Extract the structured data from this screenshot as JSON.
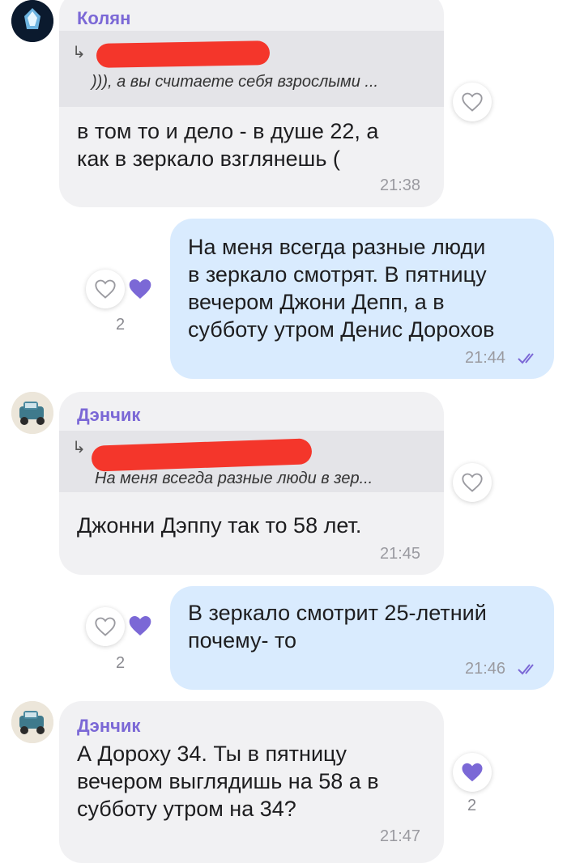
{
  "colors": {
    "incoming_bubble": "#f1f1f3",
    "outgoing_bubble": "#d9ebfe",
    "accent": "#7b68d6",
    "redaction": "#f4362b"
  },
  "messages": [
    {
      "direction": "incoming",
      "sender": "Колян",
      "reply_arrow": "↳",
      "reply_quote": "))), а вы считаете себя взрослыми ...",
      "text_lines": [
        "в том то и дело - в душе 22, а",
        "как в зеркало взглянешь ("
      ],
      "time": "21:38",
      "reaction_icon": "heart-outline-icon"
    },
    {
      "direction": "outgoing",
      "text_lines": [
        "На меня всегда разные люди",
        "в зеркало смотрят. В пятницу",
        "вечером Джони Депп, а в",
        "субботу утром Денис Дорохов"
      ],
      "time": "21:44",
      "status_icon": "double-check-icon",
      "reaction_count": "2"
    },
    {
      "direction": "incoming",
      "sender": "Дэнчик",
      "reply_arrow": "↳",
      "reply_quote": "На меня всегда разные люди в зер...",
      "text_lines": [
        "Джонни Дэппу так то 58 лет."
      ],
      "time": "21:45",
      "reaction_icon": "heart-outline-icon"
    },
    {
      "direction": "outgoing",
      "text_lines": [
        "В зеркало смотрит 25-летний",
        "почему- то"
      ],
      "time": "21:46",
      "status_icon": "double-check-icon",
      "reaction_count": "2"
    },
    {
      "direction": "incoming",
      "sender": "Дэнчик",
      "text_lines": [
        "А Дороху 34. Ты в пятницу",
        "вечером выглядишь на 58 а в",
        "субботу утром на 34?"
      ],
      "time": "21:47",
      "reaction_count": "2"
    }
  ]
}
